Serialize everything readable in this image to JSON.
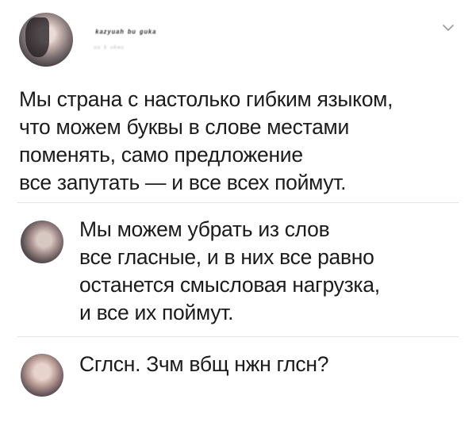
{
  "tweet": {
    "author_handle": "ᵏᵃᶻʸᵘᵃʰ ᵇᵘ ᵍᵘᵏᵃ",
    "author_subline": "ᵘᵘ ᵏ ᵘᵏᵃᵘ",
    "avatar_icon": "user-photo",
    "menu_icon": "chevron-down-icon",
    "text_lines": [
      "Мы страна с настолько гибким языком,",
      "что можем буквы в слове местами",
      "поменять, само предложение",
      "все запутать — и все всех поймут."
    ]
  },
  "replies": [
    {
      "avatar_icon": "user-photo",
      "text_lines": [
        "Мы можем убрать из слов",
        "все гласные, и в них все равно",
        "останется смысловая нагрузка,",
        "и все их поймут."
      ]
    },
    {
      "avatar_icon": "user-photo",
      "text_lines": [
        "Сглсн. Зчм вбщ нжн глсн?"
      ]
    }
  ],
  "colors": {
    "text": "#1b1b1b",
    "divider": "#e3e3e3",
    "chevron": "#9a9a9a"
  }
}
